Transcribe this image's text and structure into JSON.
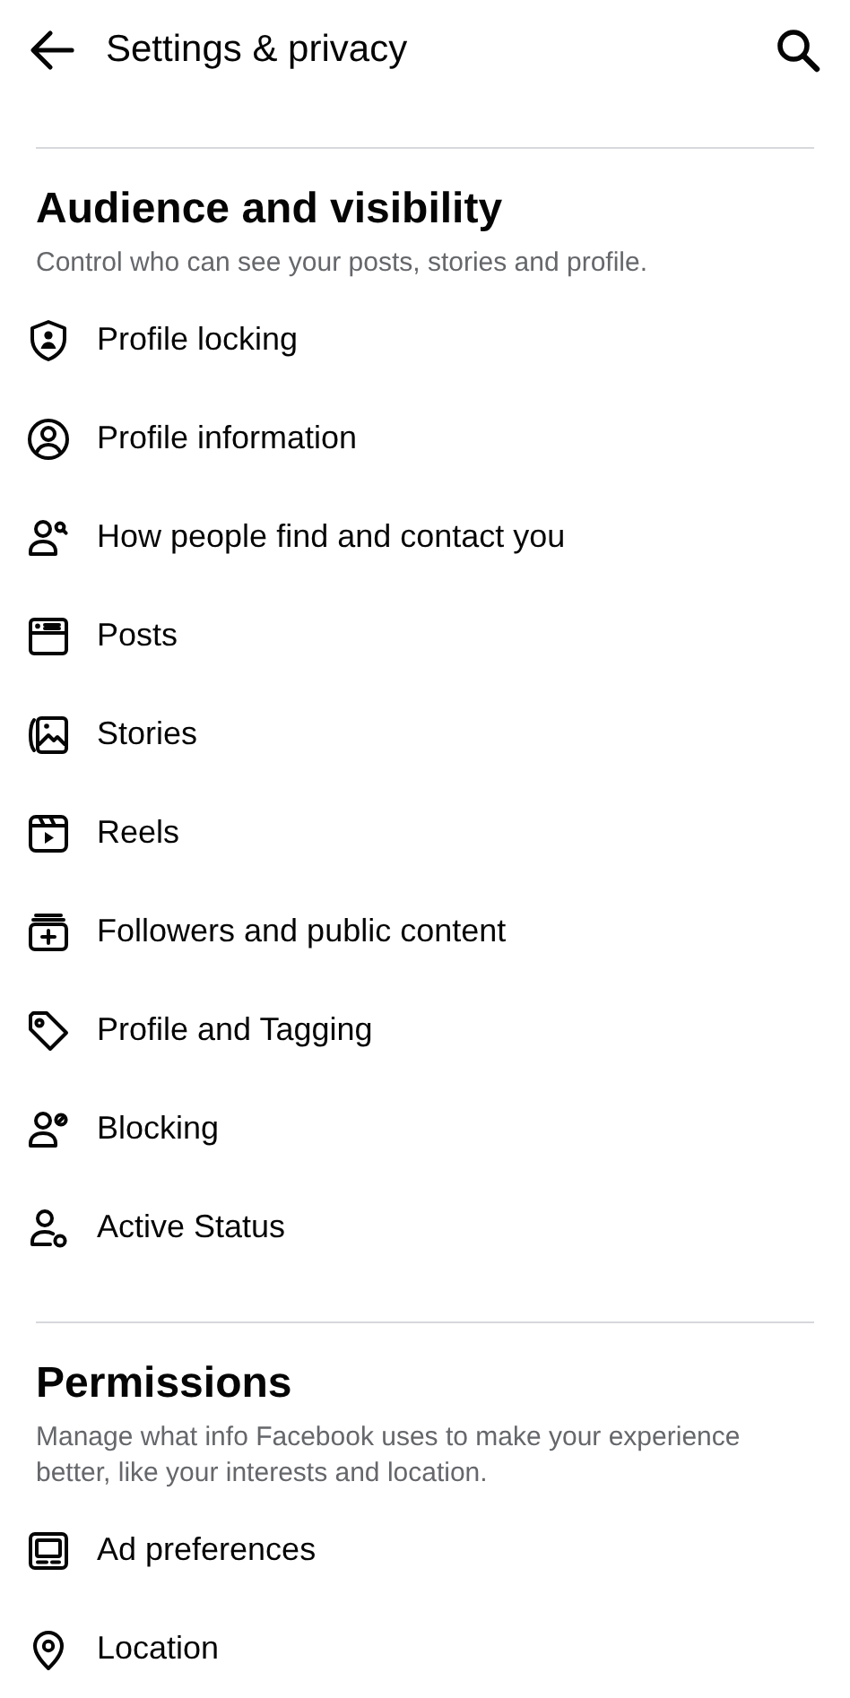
{
  "header": {
    "title": "Settings & privacy"
  },
  "sections": [
    {
      "heading": "Audience and visibility",
      "description": "Control who can see your posts, stories and profile.",
      "items": [
        {
          "kind": "shield",
          "label": "Profile locking"
        },
        {
          "kind": "person-circle",
          "label": "Profile information"
        },
        {
          "kind": "person-search",
          "label": "How people find and contact you"
        },
        {
          "kind": "post",
          "label": "Posts"
        },
        {
          "kind": "image",
          "label": "Stories"
        },
        {
          "kind": "reel",
          "label": "Reels"
        },
        {
          "kind": "stack-plus",
          "label": "Followers and public content"
        },
        {
          "kind": "tag",
          "label": "Profile and Tagging"
        },
        {
          "kind": "person-block",
          "label": "Blocking"
        },
        {
          "kind": "person-status",
          "label": "Active Status"
        }
      ]
    },
    {
      "heading": "Permissions",
      "description": "Manage what info Facebook uses to make your experience better, like your interests and location.",
      "items": [
        {
          "kind": "monitor",
          "label": "Ad preferences"
        },
        {
          "kind": "pin",
          "label": "Location"
        }
      ]
    }
  ]
}
